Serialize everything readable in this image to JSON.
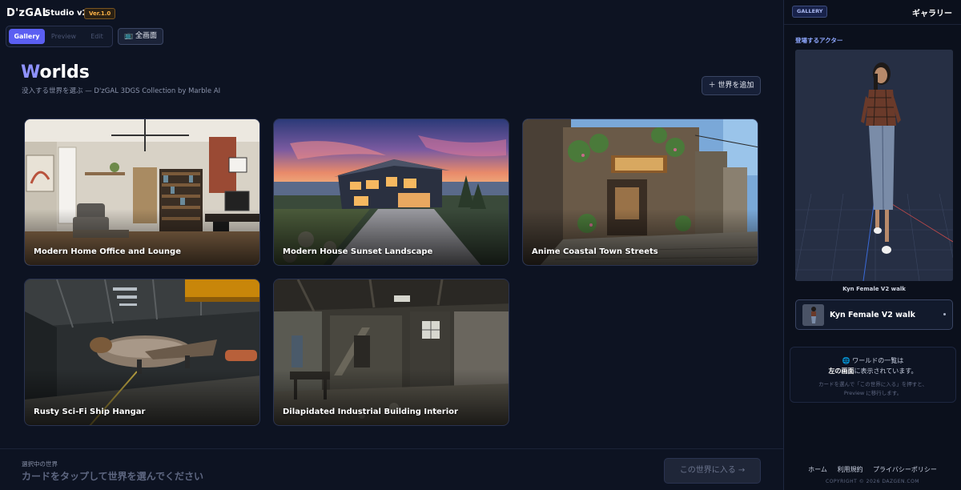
{
  "header": {
    "brand": "D'zGAL",
    "studio": "Studio v2",
    "version": "Ver.1.0",
    "modes": [
      {
        "label": "Gallery",
        "active": true
      },
      {
        "label": "Preview",
        "active": false
      },
      {
        "label": "Edit",
        "active": false
      }
    ],
    "fullscreen_label": "📺 全画面"
  },
  "worlds": {
    "title_first": "W",
    "title_rest": "orlds",
    "subtitle": "没入する世界を選ぶ — D'zGAL 3DGS Collection by Marble AI",
    "add_label": "＋ 世界を追加",
    "cards": [
      {
        "title": "Modern Home Office and Lounge"
      },
      {
        "title": "Modern House Sunset Landscape"
      },
      {
        "title": "Anime Coastal Town Streets"
      },
      {
        "title": "Rusty Sci-Fi Ship Hangar"
      },
      {
        "title": "Dilapidated Industrial Building Interior"
      }
    ]
  },
  "bottom": {
    "selected_caption": "選択中の世界",
    "selected_value": "カードをタップして世界を選んでください",
    "enter_label": "この世界に入る →"
  },
  "panel": {
    "badge": "GALLERY",
    "title": "ギャラリー",
    "actors_label": "登場するアクター",
    "viewer_caption": "Kyn Female V2 walk",
    "actor_name": "Kyn Female V2 walk",
    "info": {
      "line1": "🌐 ワールドの一覧は",
      "line2_bold": "左の画面",
      "line2_rest": "に表示されています。",
      "line3": "カードを選んで「この世界に入る」を押すと、",
      "line4": "Preview に移行します。"
    },
    "footer_links": [
      "ホーム",
      "利用規約",
      "プライバシーポリシー"
    ],
    "copyright": "COPYRIGHT © 2026 DAZGEN.COM"
  },
  "colors": {
    "background": "#0d1322",
    "accent": "#5b5ff2",
    "title_accent": "#8f92ff",
    "version_badge": "#ffb347"
  }
}
